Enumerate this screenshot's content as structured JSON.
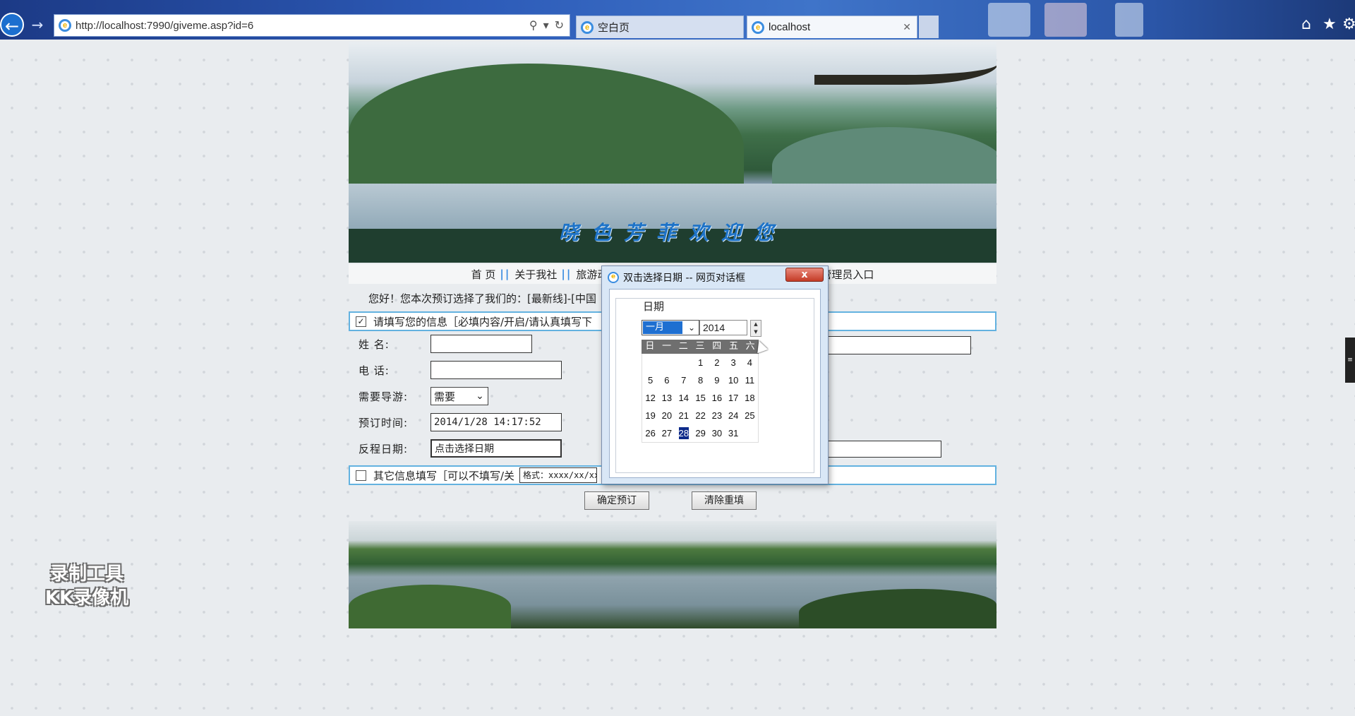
{
  "browser": {
    "url": "http://localhost:7990/giveme.asp?id=6",
    "tabs": [
      {
        "label": "空白页",
        "active": false
      },
      {
        "label": "localhost",
        "active": true
      }
    ]
  },
  "banner": {
    "text": "晓色芳菲欢迎您"
  },
  "nav": {
    "items": [
      "首 页",
      "关于我社",
      "旅游动态",
      "管理员入口"
    ],
    "separator": "||"
  },
  "greeting": "您好！您本次预订选择了我们的：[最新线]-[中国",
  "form": {
    "section1_label": "请填写您的信息［必填内容/开启/请认真填写下",
    "section1_checked": true,
    "fields": {
      "name_label": "姓    名:",
      "phone_label": "电    话:",
      "guide_label": "需要导游:",
      "guide_value": "需要",
      "booking_time_label": "预订时间:",
      "booking_time_value": "2014/1/28 14:17:52",
      "return_date_label": "反程日期:",
      "return_date_value": "点击选择日期"
    },
    "section2_label": "其它信息填写［可以不填写/关",
    "section2_checked": false,
    "format_hint": "格式：xxxx/xx/xx",
    "submit_label": "确定预订",
    "reset_label": "清除重填"
  },
  "watermark": {
    "line1": "录制工具",
    "line2": "KK录像机"
  },
  "dialog": {
    "title": "双击选择日期 -- 网页对话框",
    "close_label": "x",
    "legend": "日期",
    "month": "一月",
    "year": "2014",
    "weekdays": [
      "日",
      "一",
      "二",
      "三",
      "四",
      "五",
      "六"
    ],
    "days": [
      "",
      "",
      "",
      "1",
      "2",
      "3",
      "4",
      "5",
      "6",
      "7",
      "8",
      "9",
      "10",
      "11",
      "12",
      "13",
      "14",
      "15",
      "16",
      "17",
      "18",
      "19",
      "20",
      "21",
      "22",
      "23",
      "24",
      "25",
      "26",
      "27",
      "28",
      "29",
      "30",
      "31",
      ""
    ],
    "selected_day": "28"
  }
}
